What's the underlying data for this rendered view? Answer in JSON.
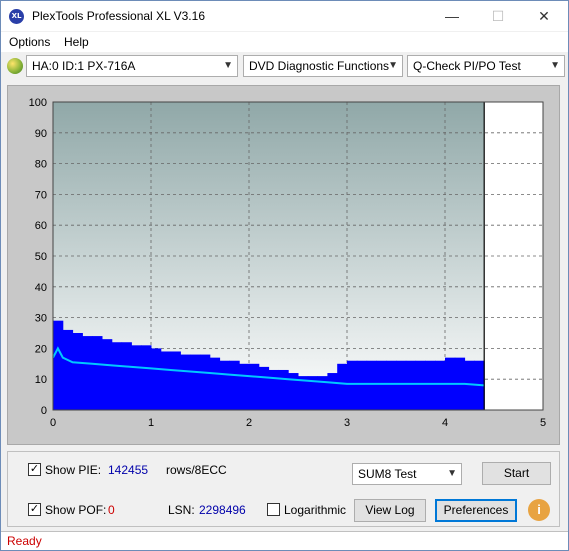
{
  "window": {
    "title": "PlexTools Professional XL V3.16",
    "app_icon_text": "XL",
    "minimize": "—",
    "maximize": "☐",
    "close": "✕"
  },
  "menu": {
    "items": [
      "Options",
      "Help"
    ]
  },
  "toolbar": {
    "drive": "HA:0 ID:1  PX-716A",
    "function": "DVD Diagnostic Functions",
    "test": "Q-Check PI/PO Test"
  },
  "colors": {
    "pie_bars": "#0000ff",
    "pif_line": "#00c8ff",
    "plot_top": "#90a8a8",
    "plot_bottom": "#ffffff"
  },
  "chart_data": {
    "type": "bar",
    "x_ticks": [
      "0",
      "1",
      "2",
      "3",
      "4",
      "5"
    ],
    "y_ticks": [
      "0",
      "10",
      "20",
      "30",
      "40",
      "50",
      "60",
      "70",
      "80",
      "90",
      "100"
    ],
    "xlim": [
      0,
      5
    ],
    "ylim": [
      0,
      100
    ],
    "data_end_x": 4.4,
    "grid": true,
    "series": [
      {
        "type": "bar",
        "x": [
          0.0,
          0.1,
          0.2,
          0.3,
          0.4,
          0.5,
          0.6,
          0.7,
          0.8,
          0.9,
          1.0,
          1.1,
          1.2,
          1.3,
          1.4,
          1.5,
          1.6,
          1.7,
          1.8,
          1.9,
          2.0,
          2.1,
          2.2,
          2.3,
          2.4,
          2.5,
          2.6,
          2.7,
          2.8,
          2.9,
          3.0,
          3.1,
          3.2,
          3.3,
          3.4,
          3.5,
          3.6,
          3.7,
          3.8,
          3.9,
          4.0,
          4.1,
          4.2,
          4.3,
          4.4
        ],
        "values": [
          29,
          26,
          25,
          24,
          24,
          23,
          22,
          22,
          21,
          21,
          20,
          19,
          19,
          18,
          18,
          18,
          17,
          16,
          16,
          15,
          15,
          14,
          13,
          13,
          12,
          11,
          11,
          11,
          12,
          15,
          16,
          16,
          16,
          16,
          16,
          16,
          16,
          16,
          16,
          16,
          17,
          17,
          16,
          16,
          15
        ]
      },
      {
        "type": "line",
        "x": [
          0.0,
          0.05,
          0.1,
          0.2,
          0.4,
          0.6,
          0.8,
          1.0,
          1.2,
          1.4,
          1.6,
          1.8,
          2.0,
          2.2,
          2.4,
          2.6,
          2.8,
          3.0,
          3.2,
          3.4,
          3.6,
          3.8,
          4.0,
          4.2,
          4.4
        ],
        "values": [
          17,
          20,
          17,
          15.5,
          15,
          14.5,
          14,
          13.5,
          13,
          12.5,
          12,
          11.5,
          11,
          10.5,
          10,
          9.5,
          9,
          8.5,
          8.5,
          8.5,
          8.5,
          8.5,
          8.5,
          8.5,
          8
        ]
      }
    ]
  },
  "controls": {
    "show_pie_label": "Show PIE:",
    "pie_value": "142455",
    "pie_unit": "rows/8ECC",
    "show_pof_label": "Show POF:",
    "pof_value": "0",
    "lsn_label": "LSN:",
    "lsn_value": "2298496",
    "logarithmic_label": "Logarithmic",
    "sum_test": "SUM8 Test",
    "start": "Start",
    "view_log": "View Log",
    "preferences": "Preferences",
    "info_icon": "i",
    "checkmark": "✓"
  },
  "status": {
    "text": "Ready"
  }
}
